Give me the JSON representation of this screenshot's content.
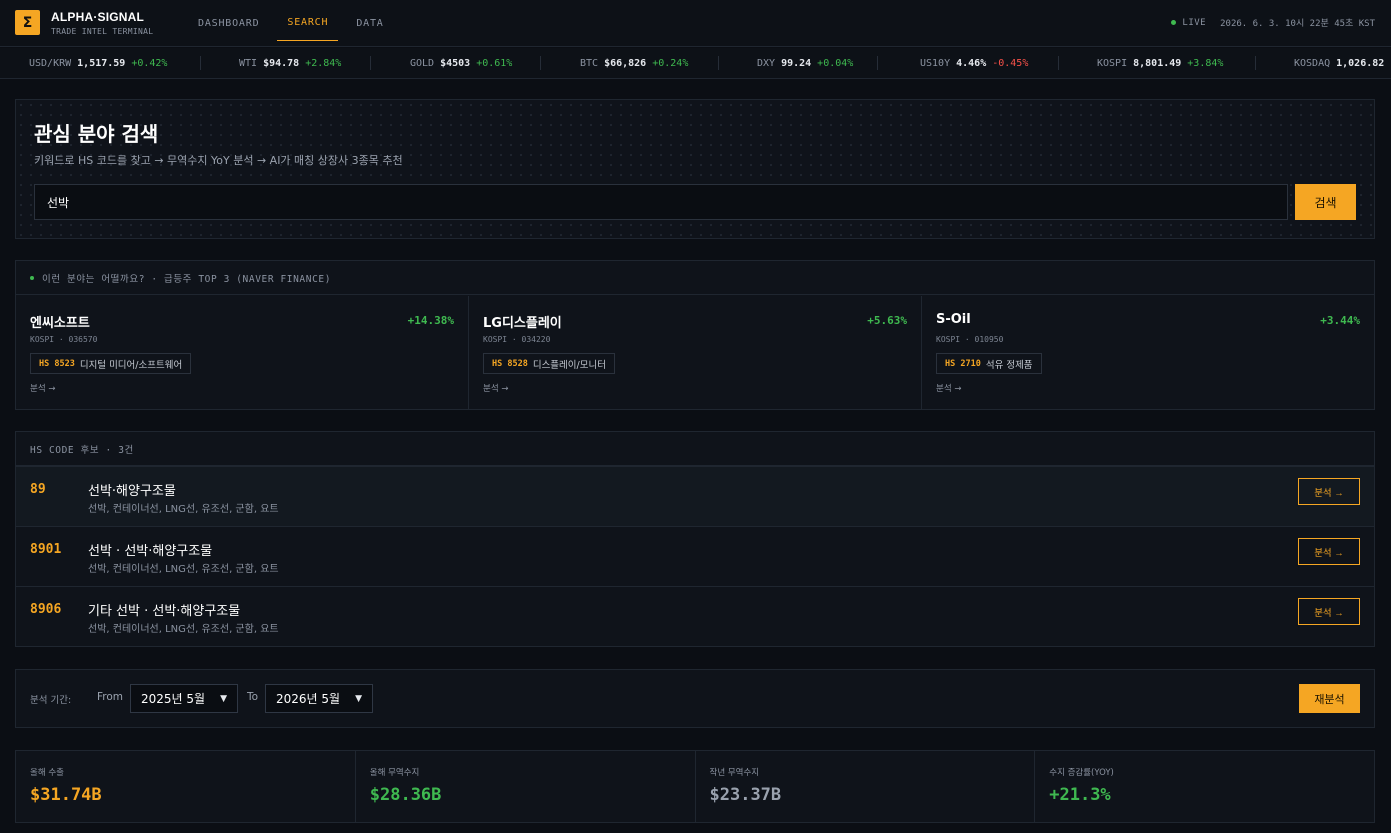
{
  "header": {
    "logo_glyph": "Σ",
    "brand_name": "ALPHA·SIGNAL",
    "brand_sub": "TRADE INTEL TERMINAL",
    "nav": [
      {
        "label": "DASHBOARD",
        "active": false
      },
      {
        "label": "SEARCH",
        "active": true
      },
      {
        "label": "DATA",
        "active": false
      }
    ],
    "live_label": "LIVE",
    "datetime": "2026. 6. 3. 10시 22분 45초 KST"
  },
  "ticker": [
    {
      "symbol": "USD/KRW",
      "value": "1,517.59",
      "change": "+0.42%",
      "direction": "up"
    },
    {
      "symbol": "WTI",
      "value": "$94.78",
      "change": "+2.84%",
      "direction": "up"
    },
    {
      "symbol": "GOLD",
      "value": "$4503",
      "change": "+0.61%",
      "direction": "up"
    },
    {
      "symbol": "BTC",
      "value": "$66,826",
      "change": "+0.24%",
      "direction": "up"
    },
    {
      "symbol": "DXY",
      "value": "99.24",
      "change": "+0.04%",
      "direction": "up"
    },
    {
      "symbol": "US10Y",
      "value": "4.46%",
      "change": "-0.45%",
      "direction": "down"
    },
    {
      "symbol": "KOSPI",
      "value": "8,801.49",
      "change": "+3.84%",
      "direction": "up"
    },
    {
      "symbol": "KOSDAQ",
      "value": "1,026.82",
      "change": "",
      "direction": "up"
    }
  ],
  "search": {
    "title": "관심 분야 검색",
    "subtitle": "키워드로 HS 코드를 찾고 → 무역수지 YoY 분석 → AI가 매칭 상장사 3종목 추천",
    "query": "선박",
    "button": "검색"
  },
  "trending": {
    "header": "이런 분야는 어떨까요? · 급등주 TOP 3 (NAVER FINANCE)",
    "cards": [
      {
        "name": "엔씨소프트",
        "change": "+14.38%",
        "meta": "KOSPI · 036570",
        "hs": "HS 8523",
        "category": "디지털 미디어/소프트웨어",
        "link": "분석 →"
      },
      {
        "name": "LG디스플레이",
        "change": "+5.63%",
        "meta": "KOSPI · 034220",
        "hs": "HS 8528",
        "category": "디스플레이/모니터",
        "link": "분석 →"
      },
      {
        "name": "S-Oil",
        "change": "+3.44%",
        "meta": "KOSPI · 010950",
        "hs": "HS 2710",
        "category": "석유 정제품",
        "link": "분석 →"
      }
    ]
  },
  "hs_candidates": {
    "header": "HS CODE 후보 · 3건",
    "rows": [
      {
        "code": "89",
        "name": "선박·해양구조물",
        "desc": "선박, 컨테이너선, LNG선, 유조선, 군함, 요트",
        "button": "분석 →"
      },
      {
        "code": "8901",
        "name": "선박 · 선박·해양구조물",
        "desc": "선박, 컨테이너선, LNG선, 유조선, 군함, 요트",
        "button": "분석 →"
      },
      {
        "code": "8906",
        "name": "기타 선박 · 선박·해양구조물",
        "desc": "선박, 컨테이너선, LNG선, 유조선, 군함, 요트",
        "button": "분석 →"
      }
    ]
  },
  "period": {
    "label": "분석 기간:",
    "from_label": "From",
    "from_value": "2025년 5월",
    "to_label": "To",
    "to_value": "2026년 5월",
    "button": "재분석"
  },
  "kpis": [
    {
      "label": "올해 수출",
      "value": "$31.74B",
      "color": "#f5a623"
    },
    {
      "label": "올해 무역수지",
      "value": "$28.36B",
      "color": "#3fb950"
    },
    {
      "label": "작년 무역수지",
      "value": "$23.37B",
      "color": "#9aa2ae"
    },
    {
      "label": "수지 증감률(YOY)",
      "value": "+21.3%",
      "color": "#3fb950"
    }
  ],
  "colors": {
    "accent": "#f5a623",
    "up": "#3fb950",
    "down": "#f85149",
    "background": "#0b0e14"
  }
}
